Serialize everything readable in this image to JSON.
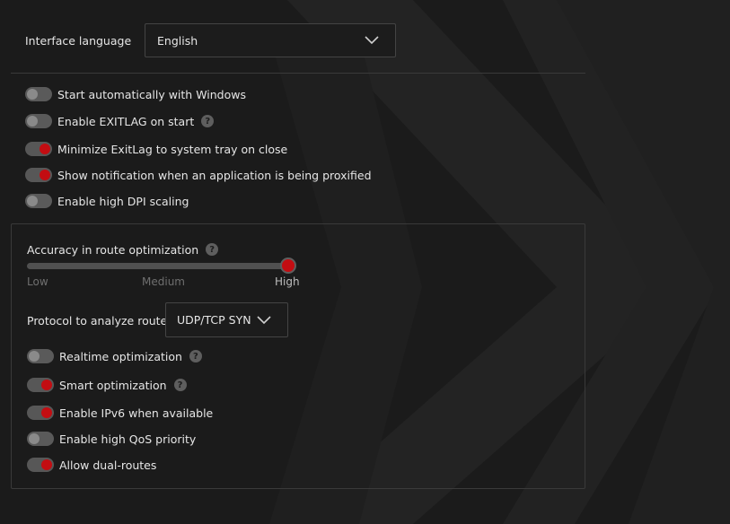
{
  "settings": {
    "language_label": "Interface language",
    "language_value": "English",
    "toggles": [
      {
        "label": "Start automatically with Windows",
        "on": false,
        "help": false
      },
      {
        "label": "Enable EXITLAG on start",
        "on": false,
        "help": true
      },
      {
        "label": "Minimize ExitLag to system tray on close",
        "on": true,
        "help": false
      },
      {
        "label": "Show notification when an application is being proxified",
        "on": true,
        "help": false
      },
      {
        "label": "Enable high DPI scaling",
        "on": false,
        "help": false
      }
    ]
  },
  "optimization": {
    "accuracy_label": "Accuracy in route optimization",
    "accuracy_value": "High",
    "slider_levels": [
      "Low",
      "Medium",
      "High"
    ],
    "protocol_label": "Protocol to analyze routes",
    "protocol_value": "UDP/TCP SYN",
    "toggles": [
      {
        "label": "Realtime optimization",
        "on": false,
        "help": true
      },
      {
        "label": "Smart optimization",
        "on": true,
        "help": true
      },
      {
        "label": "Enable IPv6 when available",
        "on": true,
        "help": false
      },
      {
        "label": "Enable high QoS priority",
        "on": false,
        "help": false
      },
      {
        "label": "Allow dual-routes",
        "on": true,
        "help": false
      }
    ]
  },
  "icons": {
    "help": "?",
    "dropdown": "chevron-down-icon"
  },
  "colors": {
    "background": "#1b1b1b",
    "accent": "#c30d12",
    "toggle_off": "#8a8a8a"
  }
}
